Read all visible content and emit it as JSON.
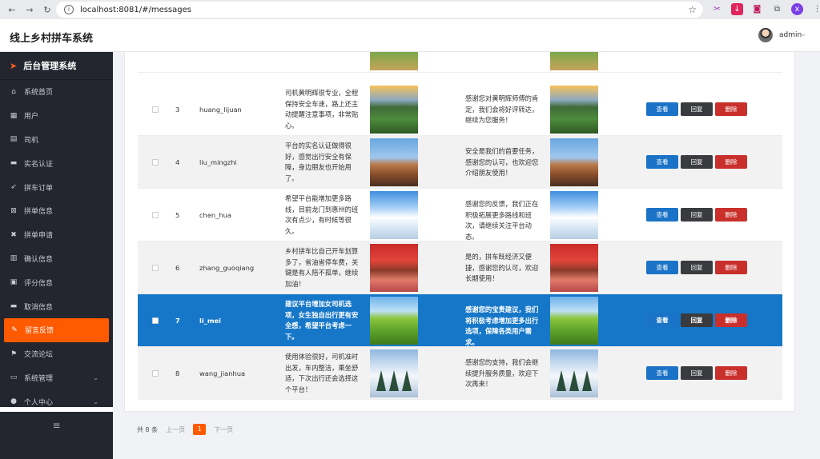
{
  "browser": {
    "url": "localhost:8081/#/messages"
  },
  "app": {
    "title": "线上乡村拼车系统",
    "user": "admin"
  },
  "sidebar": {
    "brand": "后台管理系统",
    "items": [
      {
        "label": "系统首页",
        "icon": "home-icon"
      },
      {
        "label": "用户",
        "icon": "grid-icon"
      },
      {
        "label": "司机",
        "icon": "id-card-icon"
      },
      {
        "label": "实名认证",
        "icon": "monitor-icon"
      },
      {
        "label": "拼车订单",
        "icon": "send-icon"
      },
      {
        "label": "拼单信息",
        "icon": "doc-x-icon"
      },
      {
        "label": "拼单申请",
        "icon": "ticket-icon"
      },
      {
        "label": "确认信息",
        "icon": "chart-icon"
      },
      {
        "label": "评分信息",
        "icon": "comment-icon"
      },
      {
        "label": "取消信息",
        "icon": "monitor-icon"
      },
      {
        "label": "留言反馈",
        "icon": "edit-icon",
        "active": true
      },
      {
        "label": "交流论坛",
        "icon": "flag-icon"
      },
      {
        "label": "系统管理",
        "icon": "chat-icon",
        "expandable": true
      },
      {
        "label": "个人中心",
        "icon": "user-icon",
        "expandable": true
      }
    ]
  },
  "table": {
    "actions": {
      "view": "查看",
      "reply": "回复",
      "delete": "删除"
    },
    "rows": [
      {
        "no": "3",
        "username": "huang_lijuan",
        "message": "司机黄明辉很专业，全程保持安全车速，路上还主动提醒注意事项，非常贴心。",
        "reply": "感谢您对黄明辉师傅的肯定，我们会将好评转达，继续为您服务！",
        "image": "tea-plantation-image"
      },
      {
        "no": "4",
        "username": "liu_mingzhi",
        "message": "平台的实名认证做得很好，感觉出行安全有保障，身边朋友也开始用了。",
        "reply": "安全是我们的首要任务，感谢您的认可，也欢迎您介绍朋友使用！",
        "image": "castle-image"
      },
      {
        "no": "5",
        "username": "chen_hua",
        "message": "希望平台能增加更多路线，目前龙门到惠州的班次有点少，有时候等很久。",
        "reply": "感谢您的反馈，我们正在积极拓展更多路线和班次，请继续关注平台动态。",
        "image": "snow-mountain-image"
      },
      {
        "no": "6",
        "username": "zhang_guoqiang",
        "message": "乡村拼车比自己开车划算多了，省油省停车费，关键是有人陪不孤单，继续加油！",
        "reply": "是的，拼车既经济又便捷，感谢您的认可，欢迎长期使用！",
        "image": "red-trees-image"
      },
      {
        "no": "7",
        "username": "li_mei",
        "message": "建议平台增加女司机选项，女生独自出行更有安全感，希望平台考虑一下。",
        "reply": "感谢您的宝贵建议，我们将积极考虑增加更多出行选项，保障各类用户需求。",
        "image": "green-hills-image",
        "selected": true
      },
      {
        "no": "8",
        "username": "wang_jianhua",
        "message": "使用体验很好，司机准时出发，车内整洁，乘坐舒适，下次出行还会选择这个平台！",
        "reply": "感谢您的支持，我们会继续提升服务质量，欢迎下次再来！",
        "image": "winter-forest-image"
      }
    ]
  },
  "pagination": {
    "total": "共 8 条",
    "prev": "上一页",
    "current": "1",
    "next": "下一页"
  }
}
